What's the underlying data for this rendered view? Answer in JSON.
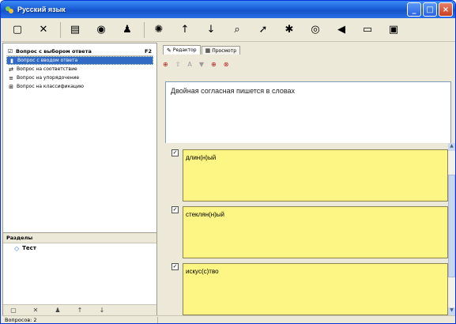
{
  "window": {
    "title": "Русский язык",
    "minimize": "_",
    "maximize": "□",
    "close": "×"
  },
  "toolbar": {
    "buttons": [
      {
        "name": "new-icon",
        "glyph": "▢"
      },
      {
        "name": "delete-icon",
        "glyph": "✕"
      },
      {
        "name": "properties-icon",
        "glyph": "▤"
      },
      {
        "name": "refresh-icon",
        "glyph": "◉"
      },
      {
        "name": "users-icon",
        "glyph": "♟"
      },
      {
        "name": "sun-icon",
        "glyph": "✺"
      },
      {
        "name": "move-up-icon",
        "glyph": "↑"
      },
      {
        "name": "move-down-icon",
        "glyph": "↓"
      },
      {
        "name": "search-icon",
        "glyph": "⌕"
      },
      {
        "name": "export-icon",
        "glyph": "➚"
      },
      {
        "name": "pin-icon",
        "glyph": "✱"
      },
      {
        "name": "help-icon",
        "glyph": "◎"
      },
      {
        "name": "sound-icon",
        "glyph": "◀"
      },
      {
        "name": "monitor-icon",
        "glyph": "▭"
      },
      {
        "name": "print-icon",
        "glyph": "▣"
      }
    ]
  },
  "question_types": {
    "header": "Вопрос с выбором ответа",
    "header_shortcut": "F2",
    "items": [
      {
        "label": "Вопрос с вводом ответа",
        "selected": true,
        "glyph": "▮"
      },
      {
        "label": "Вопрос на соответствие",
        "selected": false,
        "glyph": "⇄"
      },
      {
        "label": "Вопрос на упорядочение",
        "selected": false,
        "glyph": "≡"
      },
      {
        "label": "Вопрос на классификацию",
        "selected": false,
        "glyph": "⊞"
      }
    ]
  },
  "sections": {
    "header": "Разделы",
    "items": [
      {
        "label": "Тест"
      }
    ]
  },
  "left_toolbar": [
    "▢",
    "✕",
    "♟",
    "↑",
    "↓"
  ],
  "tabs": [
    {
      "label": "Редактор",
      "active": true
    },
    {
      "label": "Просмотр",
      "active": false
    }
  ],
  "edit_toolbar": [
    "⊕",
    "⇧",
    "A",
    "▼",
    "⊕",
    "⊗"
  ],
  "question_text": "Двойная согласная пишется в словах",
  "answers": [
    {
      "text": "длин(н)ый",
      "checked": true
    },
    {
      "text": "стеклян(н)ый",
      "checked": true
    },
    {
      "text": "искус(с)тво",
      "checked": true
    }
  ],
  "status": {
    "text": "Вопросов: 2"
  }
}
